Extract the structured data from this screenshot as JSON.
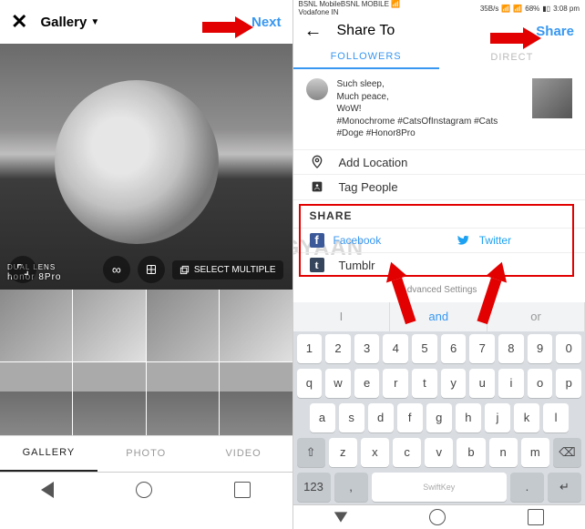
{
  "left": {
    "title": "Gallery",
    "next": "Next",
    "watermark_line1": "DUAL LENS",
    "watermark_line2": "honor 8Pro",
    "select_multiple": "SELECT MULTIPLE",
    "tabs": {
      "gallery": "GALLERY",
      "photo": "PHOTO",
      "video": "VIDEO"
    }
  },
  "right": {
    "status": {
      "carrier": "BSNL MobileBSNL MOBILE",
      "carrier2": "Vodafone IN",
      "speed": "35B/s",
      "battery": "68%",
      "time": "3:08 pm"
    },
    "title": "Share To",
    "share": "Share",
    "tabs": {
      "followers": "FOLLOWERS",
      "direct": "DIRECT"
    },
    "caption": {
      "l1": "Such sleep,",
      "l2": "Much peace,",
      "l3": "WoW!",
      "l4": "#Monochrome #CatsOfInstagram #Cats #Doge #Honor8Pro"
    },
    "add_location": "Add Location",
    "tag_people": "Tag People",
    "share_header": "SHARE",
    "facebook": "Facebook",
    "twitter": "Twitter",
    "tumblr": "Tumblr",
    "advanced": "Advanced Settings",
    "sugg": {
      "left": "I",
      "center": "and",
      "right": "or"
    },
    "space_brand": "SwiftKey"
  },
  "overlay_watermark": "MOBIGYAAN"
}
